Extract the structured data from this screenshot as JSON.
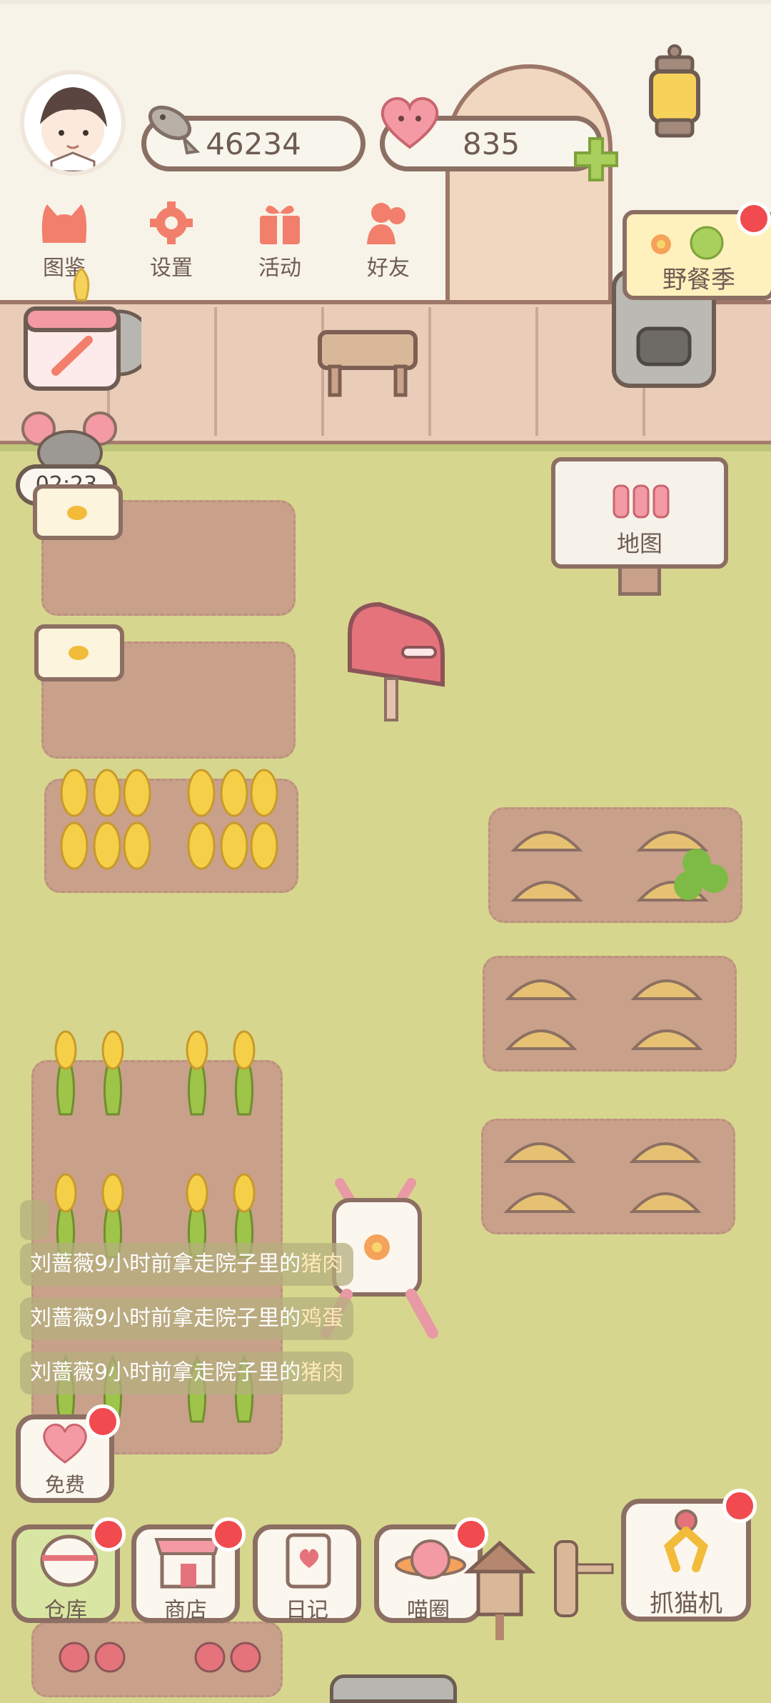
{
  "resources": {
    "fish": "46234",
    "hearts": "835"
  },
  "top_menu": [
    {
      "label": "图鉴",
      "icon": "cat-face-icon"
    },
    {
      "label": "设置",
      "icon": "gear-icon"
    },
    {
      "label": "活动",
      "icon": "gift-icon"
    },
    {
      "label": "好友",
      "icon": "friends-icon"
    }
  ],
  "event": {
    "label": "野餐季"
  },
  "timer": {
    "value": "02:23"
  },
  "map_sign": {
    "label": "地图"
  },
  "free": {
    "label": "免费"
  },
  "logs": [
    {
      "name": "刘蔷薇",
      "text": "9小时前拿走院子里的",
      "item": "猪肉"
    },
    {
      "name": "刘蔷薇",
      "text": "9小时前拿走院子里的",
      "item": "鸡蛋"
    },
    {
      "name": "刘蔷薇",
      "text": "9小时前拿走院子里的",
      "item": "猪肉"
    }
  ],
  "bottom_nav": [
    {
      "label": "仓库",
      "icon": "warehouse-icon"
    },
    {
      "label": "商店",
      "icon": "shop-icon"
    },
    {
      "label": "日记",
      "icon": "diary-icon"
    },
    {
      "label": "喵圈",
      "icon": "planet-cat-icon"
    }
  ],
  "claw": {
    "label": "抓猫机"
  },
  "colors": {
    "grass": "#d7d68e",
    "soil": "#c9a08a",
    "outline": "#8c6f63",
    "badge": "#f14a4f"
  }
}
